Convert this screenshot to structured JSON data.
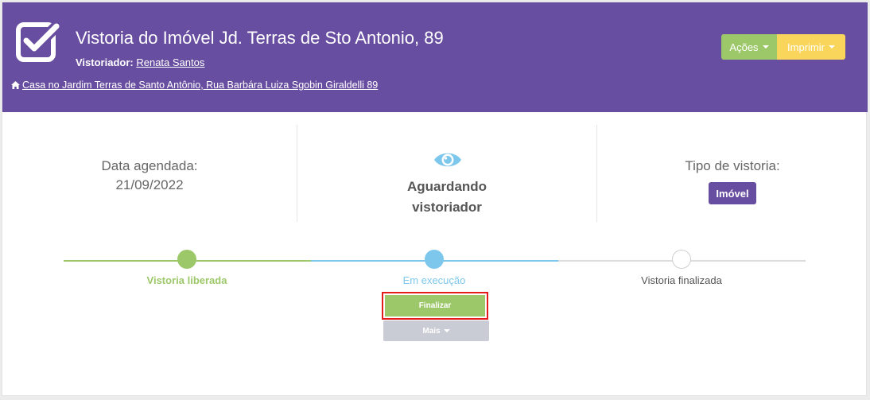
{
  "header": {
    "title": "Vistoria do Imóvel Jd. Terras de Sto Antonio, 89",
    "inspector_label": "Vistoriador:",
    "inspector_name": "Renata Santos",
    "address": "Casa no Jardim Terras de Santo Antônio, Rua Barbára Luiza Sgobin Giraldelli 89",
    "actions_label": "Ações",
    "print_label": "Imprimir"
  },
  "info": {
    "date_label": "Data agendada:",
    "date_value": "21/09/2022",
    "status_line1": "Aguardando",
    "status_line2": "vistoriador",
    "type_label": "Tipo de vistoria:",
    "type_value": "Imóvel"
  },
  "steps": [
    {
      "label": "Vistoria liberada",
      "color": "#9dc86a"
    },
    {
      "label": "Em execução",
      "color": "#7dc7ec"
    },
    {
      "label": "Vistoria finalizada",
      "color": "#555555"
    }
  ],
  "actions": {
    "finalize_label": "Finalizar",
    "more_label": "Mais"
  },
  "colors": {
    "header_bg": "#684ea0",
    "green": "#9dc86a",
    "blue": "#7dc7ec",
    "yellow": "#f9d55b",
    "highlight": "#e31b1b"
  }
}
